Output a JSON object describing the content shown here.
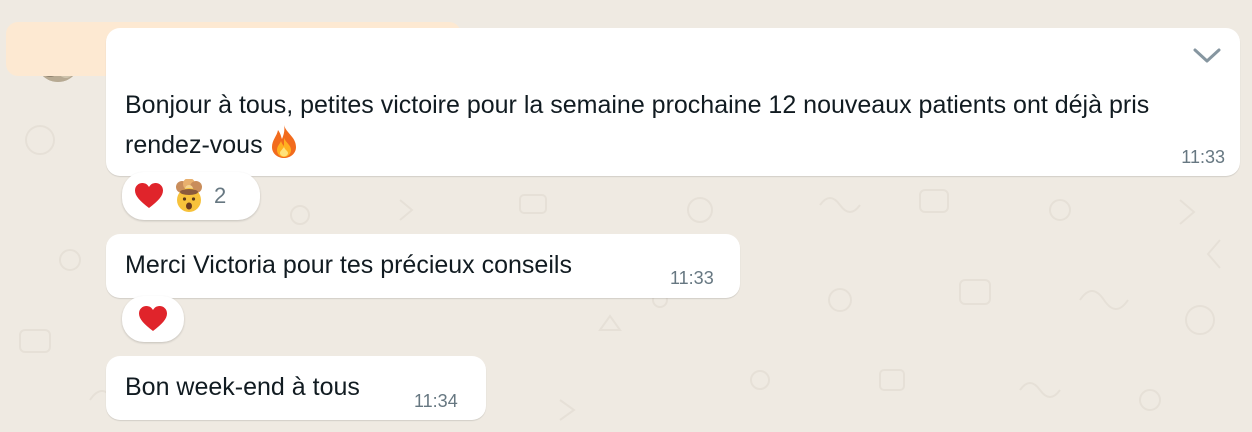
{
  "messages": [
    {
      "text": "Bonjour à tous, petites victoire pour la semaine prochaine 12 nouveaux patients ont déjà pris rendez-vous",
      "emoji": "fire-icon",
      "time": "11:33",
      "reactions": {
        "emojis": [
          "heart",
          "exploding-head"
        ],
        "count": "2"
      }
    },
    {
      "text": "Merci Victoria pour tes précieux conseils",
      "time": "11:33",
      "reactions": {
        "emojis": [
          "heart"
        ]
      }
    },
    {
      "text": "Bon week-end à tous",
      "time": "11:34"
    }
  ],
  "colors": {
    "background": "#efeae2",
    "bubble": "#ffffff",
    "redaction": "#fde9d2",
    "meta_text": "#667781",
    "heart": "#e0242b",
    "fire": "#f26b1d"
  }
}
